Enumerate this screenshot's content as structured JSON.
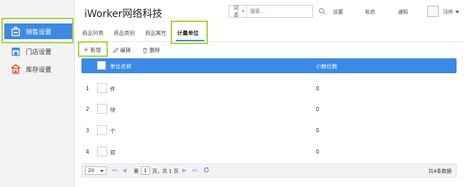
{
  "sidebar": {
    "items": [
      {
        "label": "销售设置",
        "icon": "shopping-bag-icon",
        "active": true
      },
      {
        "label": "门店设置",
        "icon": "store-icon",
        "active": false
      },
      {
        "label": "库存设置",
        "icon": "warehouse-icon",
        "active": false
      }
    ]
  },
  "header": {
    "brand": "iWorker网络科技",
    "search": {
      "scope": "动态",
      "placeholder": "搜索..."
    },
    "links": [
      "设置",
      "私信",
      "通知"
    ],
    "user": "冯帅"
  },
  "tabs": [
    "商品列表",
    "商品类别",
    "商品属性",
    "计量单位"
  ],
  "active_tab": "计量单位",
  "toolbar": {
    "add": "新增",
    "edit": "编辑",
    "delete": "删除"
  },
  "table": {
    "columns": [
      "单位名称",
      "小数位数"
    ],
    "rows": [
      {
        "index": "1",
        "name": "件",
        "decimals": "0"
      },
      {
        "index": "2",
        "name": "块",
        "decimals": "0"
      },
      {
        "index": "3",
        "name": "个",
        "decimals": "0"
      },
      {
        "index": "4",
        "name": "双",
        "decimals": "0"
      }
    ]
  },
  "pager": {
    "page_size": "20",
    "page_prefix": "第",
    "page": "1",
    "page_suffix": "页，共 1 页",
    "total": "共4条数据"
  },
  "colors": {
    "accent": "#3b8ae4",
    "highlight": "#a8d53b"
  }
}
